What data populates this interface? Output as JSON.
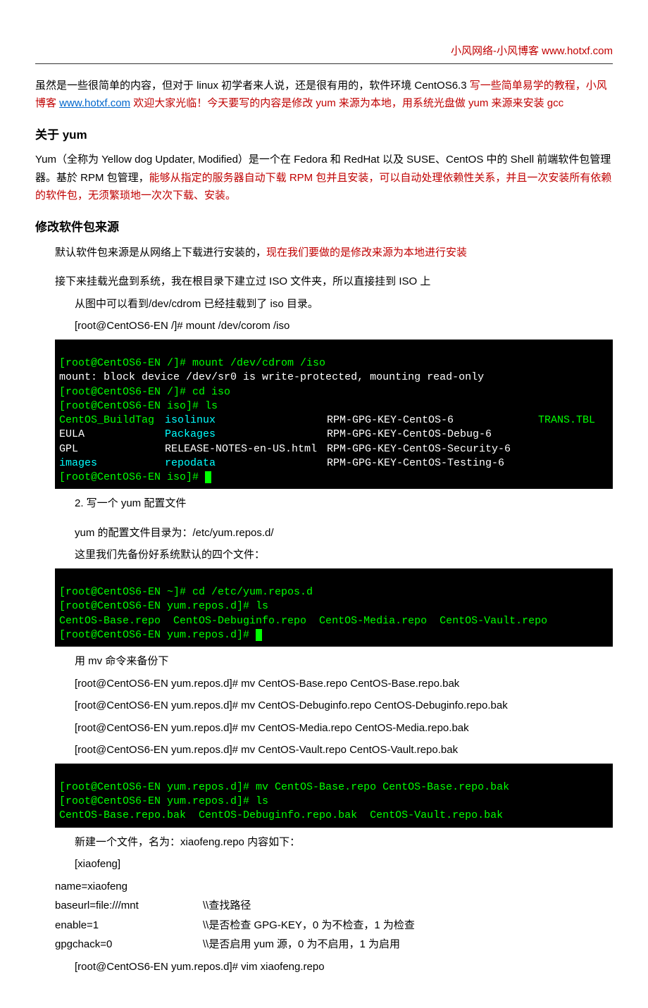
{
  "header": {
    "brand": "小风网络-小风博客",
    "url": "www.hotxf.com"
  },
  "intro": {
    "pre": "虽然是一些很简单的内容，但对于 linux 初学者来人说，还是很有用的，软件环境 CentOS6.3 ",
    "red1": "写一些简单易学的教程，小风博客 ",
    "link": "www.hotxf.com",
    "red2": " 欢迎大家光临！今天要写的内容是修改 yum 来源为本地，用系统光盘做 yum 来源来安装 gcc"
  },
  "sec1": {
    "title": "关于 yum",
    "p1_a": "Yum（全称为 Yellow dog Updater, Modified）是一个在 Fedora 和 RedHat 以及 SUSE、CentOS 中的 Shell 前端软件包管理器。基於 RPM 包管理，",
    "p1_b": "能够从指定的服务器自动下载 RPM 包并且安装，可以自动处理依赖性关系，并且一次安装所有依赖的软件包，无须繁琐地一次次下载、安装。"
  },
  "sec2": {
    "title": "修改软件包来源",
    "p1a": "默认软件包来源是从网络上下载进行安装的，",
    "p1b": "现在我们要做的是修改来源为本地进行安装",
    "p2": "接下来挂载光盘到系统，我在根目录下建立过 ISO 文件夹，所以直接挂到 ISO 上",
    "p3": "从图中可以看到/dev/cdrom 已经挂载到了 iso 目录。",
    "p4": "[root@CentOS6-EN /]# mount   /dev/corom /iso"
  },
  "term1": {
    "l1": "[root@CentOS6-EN /]# mount /dev/cdrom /iso",
    "l2": "mount: block device /dev/sr0 is write-protected, mounting read-only",
    "l3": "[root@CentOS6-EN /]# cd iso",
    "l4": "[root@CentOS6-EN iso]# ls",
    "c_a1": "CentOS_BuildTag",
    "c_b1": "isolinux",
    "c_c1": "RPM-GPG-KEY-CentOS-6",
    "c_d1": "TRANS.TBL",
    "c_a2": "EULA",
    "c_b2": "Packages",
    "c_c2": "RPM-GPG-KEY-CentOS-Debug-6",
    "c_a3": "GPL",
    "c_b3": "RELEASE-NOTES-en-US.html",
    "c_c3": "RPM-GPG-KEY-CentOS-Security-6",
    "c_a4": "images",
    "c_b4": "repodata",
    "c_c4": "RPM-GPG-KEY-CentOS-Testing-6",
    "l9": "[root@CentOS6-EN iso]# ",
    "cursor": " "
  },
  "sec3": {
    "p1": "2. 写一个 yum 配置文件",
    "p2": "yum 的配置文件目录为：/etc/yum.repos.d/",
    "p3": " 这里我们先备份好系统默认的四个文件："
  },
  "term2": {
    "l1": "[root@CentOS6-EN ~]# cd /etc/yum.repos.d",
    "l2": "[root@CentOS6-EN yum.repos.d]# ls",
    "l3": "CentOS-Base.repo  CentOS-Debuginfo.repo  CentOS-Media.repo  CentOS-Vault.repo",
    "l4": "[root@CentOS6-EN yum.repos.d]# ",
    "cursor": " "
  },
  "sec4": {
    "p1": "用 mv 命令来备份下",
    "c1": "[root@CentOS6-EN yum.repos.d]# mv CentOS-Base.repo CentOS-Base.repo.bak",
    "c2": "[root@CentOS6-EN yum.repos.d]# mv CentOS-Debuginfo.repo CentOS-Debuginfo.repo.bak",
    "c3": "[root@CentOS6-EN yum.repos.d]# mv CentOS-Media.repo CentOS-Media.repo.bak",
    "c4": "[root@CentOS6-EN yum.repos.d]# mv CentOS-Vault.repo CentOS-Vault.repo.bak"
  },
  "term3": {
    "l1": "[root@CentOS6-EN yum.repos.d]# mv CentOS-Base.repo CentOS-Base.repo.bak",
    "l2": "[root@CentOS6-EN yum.repos.d]# ls",
    "l3": "CentOS-Base.repo.bak  CentOS-Debuginfo.repo.bak  CentOS-Vault.repo.bak"
  },
  "sec5": {
    "p1": "新建一个文件，名为：xiaofeng.repo    内容如下：",
    "l1": " [xiaofeng]",
    "l2k": "name=xiaofeng",
    "l2v": "",
    "l3k": "baseurl=file:///mnt",
    "l3v": "\\\\查找路径",
    "l4k": "enable=1",
    "l4v": "\\\\是否检查 GPG-KEY，0 为不检查，1 为检查",
    "l5k": "gpgchack=0",
    "l5v": "\\\\是否启用 yum 源，0 为不启用，1 为启用",
    "l6": "[root@CentOS6-EN yum.repos.d]# vim xiaofeng.repo"
  }
}
